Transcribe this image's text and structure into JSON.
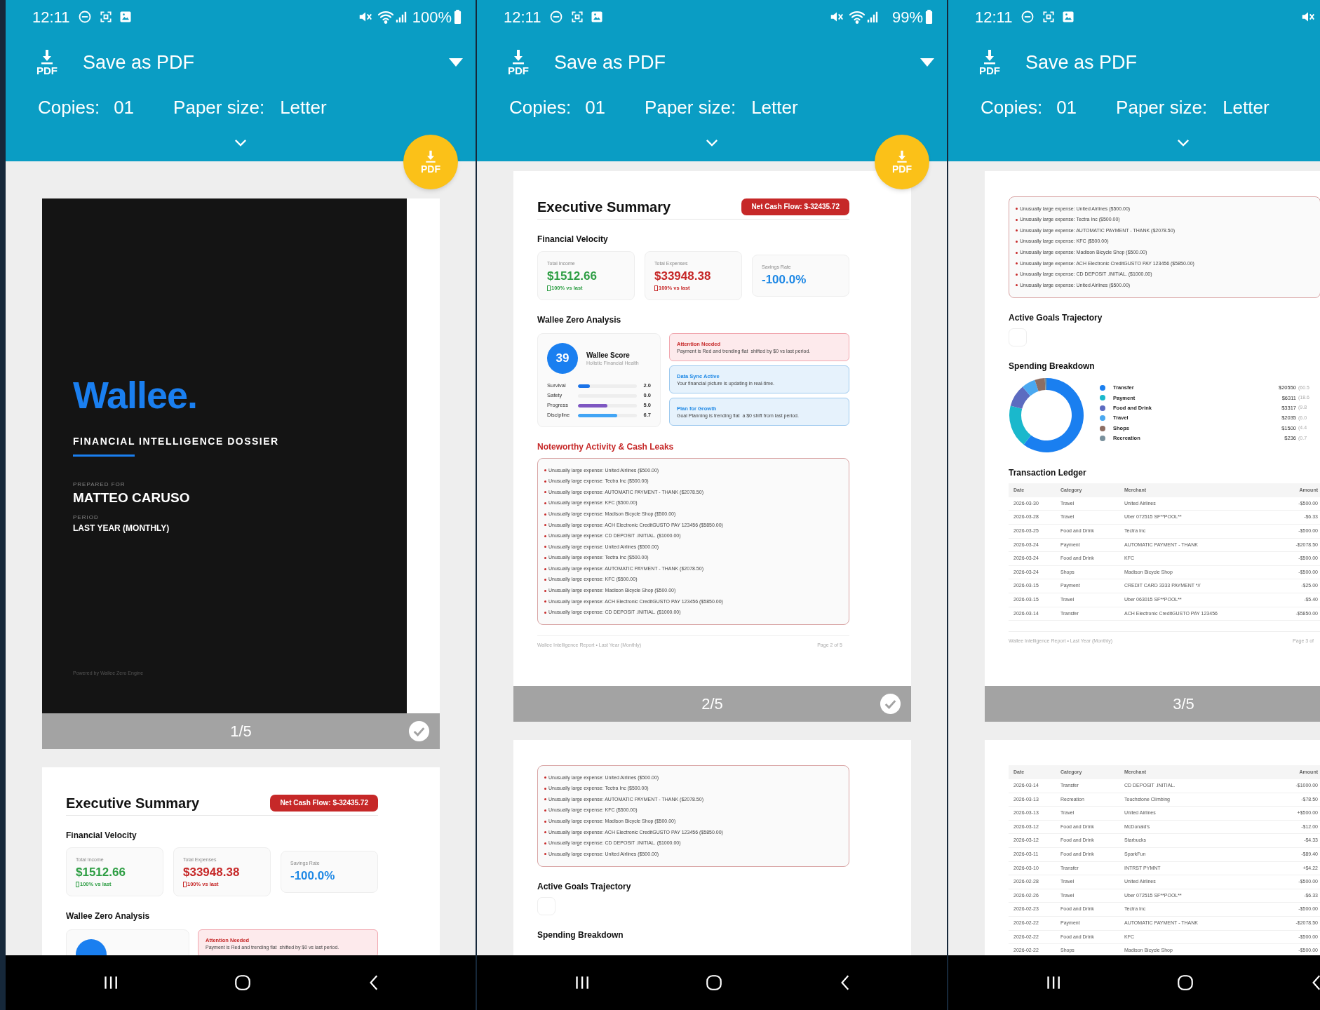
{
  "panels": [
    {
      "status_bar": {
        "time": "12:11",
        "battery": "100%"
      },
      "print_header": {
        "icon_label": "PDF",
        "destination": "Save as PDF",
        "copies_label": "Copies:",
        "copies": "01",
        "paper_size_label": "Paper size:",
        "paper_size": "Letter"
      },
      "fab_label": "PDF",
      "pages": [
        {
          "kind": "cover",
          "brand": "Wallee.",
          "subtitle": "FINANCIAL INTELLIGENCE DOSSIER",
          "prepared_label": "PREPARED FOR",
          "prepared_for": "MATTEO CARUSO",
          "period_label": "PERIOD",
          "period": "LAST YEAR (MONTHLY)",
          "powered_by": "Powered by Wallee Zero Engine",
          "page_number": "1/5",
          "selected": true
        },
        {
          "kind": "report",
          "sections": [
            {
              "kind": "summary_header",
              "title": "Executive Summary",
              "badge": "Net Cash Flow: $-32435.72"
            },
            {
              "kind": "heading",
              "text": "Financial Velocity"
            },
            {
              "kind": "metrics",
              "items": [
                {
                  "kind": "positive",
                  "label": "Total Income",
                  "value": "$1512.66",
                  "change": "100% vs last"
                },
                {
                  "kind": "negative",
                  "label": "Total Expenses",
                  "value": "$33948.38",
                  "change": "100% vs last"
                },
                {
                  "kind": "neutral",
                  "label": "Savings Rate",
                  "value": "-100.0%"
                }
              ]
            },
            {
              "kind": "heading",
              "text": "Wallee Zero Analysis"
            },
            {
              "kind": "analysis",
              "notes": [
                {
                  "kind": "alert",
                  "title": "Attention Needed",
                  "text": "Payment is Red and trending flat  shifted by $0 vs last period."
                }
              ]
            }
          ]
        }
      ]
    },
    {
      "status_bar": {
        "time": "12:11",
        "battery": "99%"
      },
      "print_header": {
        "icon_label": "PDF",
        "destination": "Save as PDF",
        "copies_label": "Copies:",
        "copies": "01",
        "paper_size_label": "Paper size:",
        "paper_size": "Letter"
      },
      "fab_label": "PDF",
      "pages": [
        {
          "kind": "report",
          "page_number": "2/5",
          "selected": true,
          "sections": [
            {
              "kind": "summary_header",
              "title": "Executive Summary",
              "badge": "Net Cash Flow: $-32435.72"
            },
            {
              "kind": "heading",
              "text": "Financial Velocity"
            },
            {
              "kind": "metrics",
              "items": [
                {
                  "kind": "positive",
                  "label": "Total Income",
                  "value": "$1512.66",
                  "change": "100% vs last"
                },
                {
                  "kind": "negative",
                  "label": "Total Expenses",
                  "value": "$33948.38",
                  "change": "100% vs last"
                },
                {
                  "kind": "neutral",
                  "label": "Savings Rate",
                  "value": "-100.0%"
                }
              ]
            },
            {
              "kind": "heading",
              "text": "Wallee Zero Analysis"
            },
            {
              "kind": "analysis",
              "score": {
                "value": "39",
                "title": "Wallee Score",
                "subtitle": "Holistic Financial Health",
                "factors": [
                  {
                    "label": "Survival",
                    "level": 0.2,
                    "reading": "2.0",
                    "color": "#1a73e8"
                  },
                  {
                    "label": "Safety",
                    "reading": "0.0"
                  },
                  {
                    "label": "Progress",
                    "level": 0.5,
                    "reading": "5.0",
                    "color": "#7e57c2"
                  },
                  {
                    "label": "Discipline",
                    "level": 0.67,
                    "reading": "6.7",
                    "color": "#42a5f5"
                  }
                ]
              },
              "notes": [
                {
                  "kind": "alert",
                  "title": "Attention Needed",
                  "text": "Payment is Red and trending flat  shifted by $0 vs last period."
                },
                {
                  "kind": "info",
                  "title": "Data Sync Active",
                  "text": "Your financial picture is updating in real-time."
                },
                {
                  "kind": "info",
                  "title": "Plan for Growth",
                  "text": "Goal Planning is trending flat  a $0 shift from last period."
                }
              ]
            },
            {
              "kind": "alert_heading",
              "text": "Noteworthy Activity & Cash Leaks"
            },
            {
              "kind": "leak_list",
              "items": [
                "Unusually large expense: United Airlines ($500.00)",
                "Unusually large expense: Tectra Inc ($500.00)",
                "Unusually large expense: AUTOMATIC PAYMENT - THANK ($2078.50)",
                "Unusually large expense: KFC ($500.00)",
                "Unusually large expense: Madison Bicycle Shop ($500.00)",
                "Unusually large expense: ACH Electronic CreditGUSTO PAY 123456 ($5850.00)",
                "Unusually large expense: CD DEPOSIT .INITIAL. ($1000.00)",
                "Unusually large expense: United Airlines ($500.00)",
                "Unusually large expense: Tectra Inc ($500.00)",
                "Unusually large expense: AUTOMATIC PAYMENT - THANK ($2078.50)",
                "Unusually large expense: KFC ($500.00)",
                "Unusually large expense: Madison Bicycle Shop ($500.00)",
                "Unusually large expense: ACH Electronic CreditGUSTO PAY 123456 ($5850.00)",
                "Unusually large expense: CD DEPOSIT .INITIAL. ($1000.00)"
              ]
            },
            {
              "kind": "report_footer",
              "left": "Wallee Intelligence Report • Last Year (Monthly)",
              "right": "Page 2 of 5"
            }
          ]
        },
        {
          "kind": "report",
          "sections": [
            {
              "kind": "leak_list",
              "items": [
                "Unusually large expense: United Airlines ($500.00)",
                "Unusually large expense: Tectra Inc ($500.00)",
                "Unusually large expense: AUTOMATIC PAYMENT - THANK ($2078.50)",
                "Unusually large expense: KFC ($500.00)",
                "Unusually large expense: Madison Bicycle Shop ($500.00)",
                "Unusually large expense: ACH Electronic CreditGUSTO PAY 123456 ($5850.00)",
                "Unusually large expense: CD DEPOSIT .INITIAL. ($1000.00)",
                "Unusually large expense: United Airlines ($500.00)"
              ]
            },
            {
              "kind": "heading",
              "text": "Active Goals Trajectory"
            },
            {
              "kind": "placeholder_box"
            },
            {
              "kind": "heading",
              "text": "Spending Breakdown"
            }
          ]
        }
      ]
    },
    {
      "status_bar": {
        "time": "12:11"
      },
      "print_header": {
        "icon_label": "PDF",
        "destination": "Save as PDF",
        "copies_label": "Copies:",
        "copies": "01",
        "paper_size_label": "Paper size:",
        "paper_size": "Letter"
      },
      "pages": [
        {
          "kind": "report",
          "page_number": "3/5",
          "sections": [
            {
              "kind": "leak_list",
              "items": [
                "Unusually large expense: United Airlines ($500.00)",
                "Unusually large expense: Tectra Inc ($500.00)",
                "Unusually large expense: AUTOMATIC PAYMENT - THANK ($2078.50)",
                "Unusually large expense: KFC ($500.00)",
                "Unusually large expense: Madison Bicycle Shop ($500.00)",
                "Unusually large expense: ACH Electronic CreditGUSTO PAY 123456 ($5850.00)",
                "Unusually large expense: CD DEPOSIT .INITIAL. ($1000.00)",
                "Unusually large expense: United Airlines ($500.00)"
              ]
            },
            {
              "kind": "heading",
              "text": "Active Goals Trajectory"
            },
            {
              "kind": "placeholder_box"
            },
            {
              "kind": "heading",
              "text": "Spending Breakdown"
            },
            {
              "kind": "donut",
              "chart_data": {
                "type": "donut",
                "categories": [
                  "Transfer",
                  "Payment",
                  "Food and Drink",
                  "Travel",
                  "Shops",
                  "Recreation"
                ],
                "values": [
                  60.5,
                  18.6,
                  9.8,
                  6.0,
                  4.4,
                  0.7
                ]
              },
              "legend": [
                {
                  "color": "#1a7ff0",
                  "amount": "$20550",
                  "share": "(60.5"
                },
                {
                  "color": "#1ab8cc",
                  "amount": "$6311",
                  "share": "(18.6"
                },
                {
                  "color": "#5c6bc0",
                  "amount": "$3317",
                  "share": "(9.8"
                },
                {
                  "color": "#4aa8f0",
                  "amount": "$2035",
                  "share": "(6.0"
                },
                {
                  "color": "#8d6e63",
                  "amount": "$1500",
                  "share": "(4.4"
                },
                {
                  "color": "#78909c",
                  "amount": "$236",
                  "share": "(0.7"
                }
              ]
            },
            {
              "kind": "heading",
              "text": "Transaction Ledger"
            },
            {
              "kind": "ledger",
              "columns": [
                "Date",
                "Category",
                "Merchant",
                "Amount"
              ],
              "rows": [
                [
                  "2026-03-30",
                  "Travel",
                  "United Airlines",
                  "-$500.00"
                ],
                [
                  "2026-03-28",
                  "Travel",
                  "Uber 072515 SF**POOL**",
                  "-$6.33"
                ],
                [
                  "2026-03-25",
                  "Food and Drink",
                  "Tectra Inc",
                  "-$500.00"
                ],
                [
                  "2026-03-24",
                  "Payment",
                  "AUTOMATIC PAYMENT - THANK",
                  "-$2078.50"
                ],
                [
                  "2026-03-24",
                  "Food and Drink",
                  "KFC",
                  "-$500.00"
                ],
                [
                  "2026-03-24",
                  "Shops",
                  "Madison Bicycle Shop",
                  "-$500.00"
                ],
                [
                  "2026-03-15",
                  "Payment",
                  "CREDIT CARD 3333 PAYMENT *//",
                  "-$25.00"
                ],
                [
                  "2026-03-15",
                  "Travel",
                  "Uber 063015 SF**POOL**",
                  "-$5.40"
                ],
                [
                  "2026-03-14",
                  "Transfer",
                  "ACH Electronic CreditGUSTO PAY 123456",
                  "-$5850.00"
                ]
              ]
            },
            {
              "kind": "report_footer",
              "left": "Wallee Intelligence Report • Last Year (Monthly)",
              "right": "Page 3 of"
            }
          ]
        },
        {
          "kind": "report",
          "sections": [
            {
              "kind": "ledger",
              "columns": [
                "Date",
                "Category",
                "Merchant",
                "Amount"
              ],
              "rows": [
                [
                  "2026-03-14",
                  "Transfer",
                  "CD DEPOSIT .INITIAL.",
                  "-$1000.00"
                ],
                [
                  "2026-03-13",
                  "Recreation",
                  "Touchstone Climbing",
                  "-$78.50"
                ],
                [
                  "2026-03-13",
                  "Travel",
                  "United Airlines",
                  "+$500.00"
                ],
                [
                  "2026-03-12",
                  "Food and Drink",
                  "McDonald's",
                  "-$12.00"
                ],
                [
                  "2026-03-12",
                  "Food and Drink",
                  "Starbucks",
                  "-$4.33"
                ],
                [
                  "2026-03-11",
                  "Food and Drink",
                  "SparkFun",
                  "-$89.40"
                ],
                [
                  "2026-03-10",
                  "Transfer",
                  "INTRST PYMNT",
                  "+$4.22"
                ],
                [
                  "2026-02-28",
                  "Travel",
                  "United Airlines",
                  "-$500.00"
                ],
                [
                  "2026-02-26",
                  "Travel",
                  "Uber 072515 SF**POOL**",
                  "-$6.33"
                ],
                [
                  "2026-02-23",
                  "Food and Drink",
                  "Tectra Inc",
                  "-$500.00"
                ],
                [
                  "2026-02-22",
                  "Payment",
                  "AUTOMATIC PAYMENT - THANK",
                  "-$2078.50"
                ],
                [
                  "2026-02-22",
                  "Food and Drink",
                  "KFC",
                  "-$500.00"
                ],
                [
                  "2026-02-22",
                  "Shops",
                  "Madison Bicycle Shop",
                  "-$500.00"
                ]
              ]
            }
          ]
        }
      ]
    }
  ]
}
